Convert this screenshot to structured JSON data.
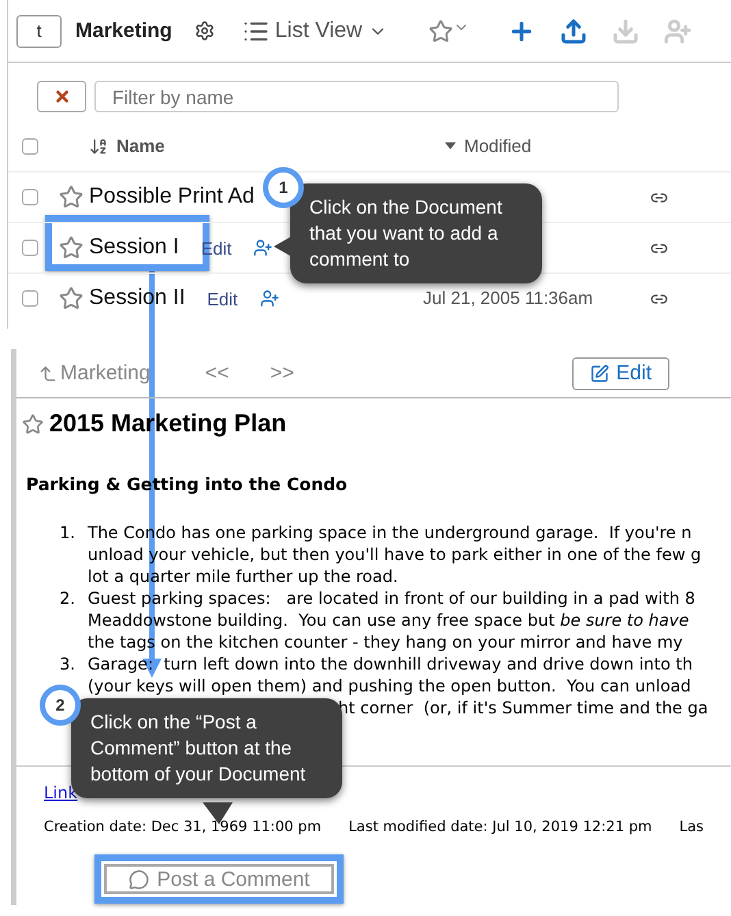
{
  "folder": {
    "up_label": "t",
    "title": "Marketing",
    "view": "List View"
  },
  "toolbar": [
    {
      "kind": "add",
      "disabled": false
    },
    {
      "kind": "upload",
      "disabled": false
    },
    {
      "kind": "download",
      "disabled": true
    },
    {
      "kind": "share",
      "disabled": true
    }
  ],
  "filter": {
    "placeholder": "Filter by name"
  },
  "table": {
    "select_all": {
      "checked": false
    },
    "columns": [
      "Name",
      "Modified"
    ],
    "rows": [
      {
        "name": "Possible Print Ad",
        "checked": false,
        "starred": false
      },
      {
        "name": "Session I",
        "checked": false,
        "starred": false,
        "edit": "Edit"
      },
      {
        "name": "Session II",
        "checked": false,
        "starred": false,
        "edit": "Edit",
        "modified": "Jul 21, 2005 11:36am"
      }
    ]
  },
  "document": {
    "back": "Marketing",
    "prev": "<<",
    "next": ">>",
    "edit": "Edit",
    "title": "2015 Marketing Plan",
    "starred": false,
    "heading": "Parking & Getting into the Condo",
    "items": [
      {
        "number": "1.",
        "lines": [
          "The Condo has one parking space in the underground garage.  If you're n",
          "unload your vehicle, but then you'll have to park either in one of the few g",
          "lot a quarter mile further up the road."
        ]
      },
      {
        "number": "2.",
        "lines": [
          "Guest parking spaces:   are located in front of our building in a pad with 8",
          "Meaddowstone building.  You can use any free space but *be sure to have*",
          "the tags on the kitchen counter - they hang on your mirror and have my"
        ]
      },
      {
        "number": "3.",
        "lines": [
          "Garage:  turn left down into the downhill driveway and drive down into th",
          "(your keys will open them) and pushing the open button.  You can unload"
        ],
        "tail": "ht corner  (or, if it's Summer time and the ga"
      }
    ],
    "link": "Link",
    "meta": [
      "Creation date: Dec 31, 1969 11:00 pm",
      "Last modified date: Jul 10, 2019 12:21 pm",
      "Las"
    ],
    "comment_button": "Post a Comment"
  },
  "callouts": [
    {
      "number": "1",
      "text": "Click on the Document that you want to add a comment to"
    },
    {
      "number": "2",
      "text": "Click on the “Post a Comment” button at the bottom of your Document"
    }
  ]
}
